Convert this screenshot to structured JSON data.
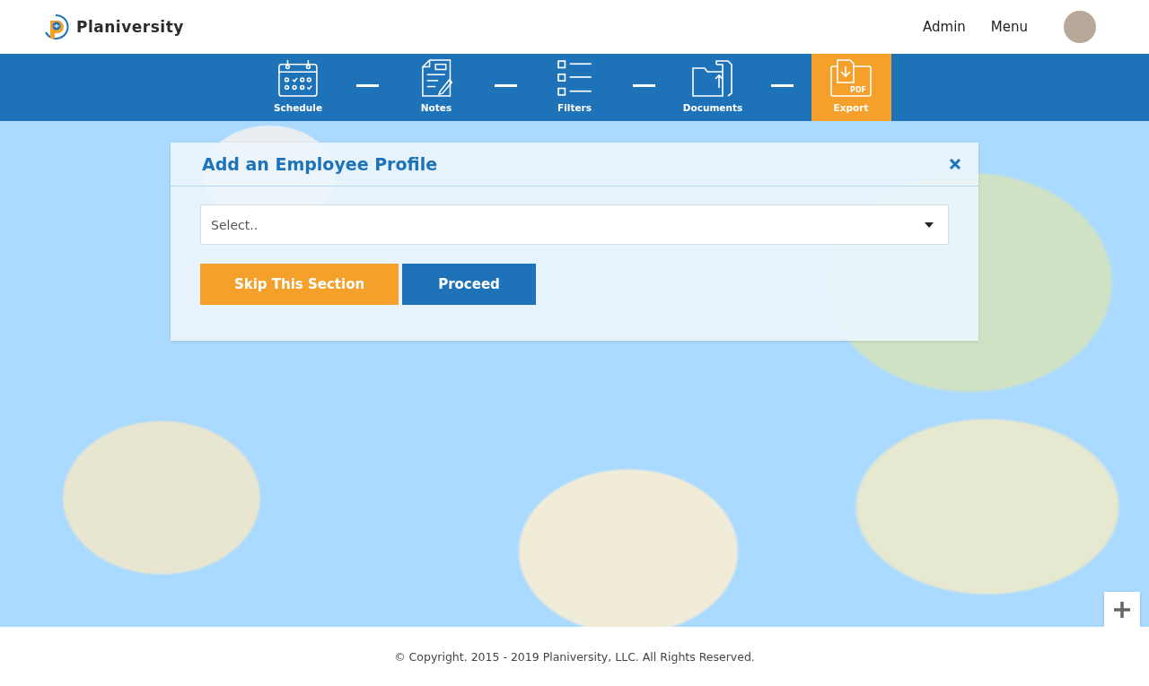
{
  "header": {
    "brand": "Planiversity",
    "nav": [
      {
        "label": "Admin"
      },
      {
        "label": "Menu"
      }
    ]
  },
  "steps": [
    {
      "label": "Schedule",
      "kind": "schedule",
      "selected": false
    },
    {
      "label": "Notes",
      "kind": "notes",
      "selected": false
    },
    {
      "label": "Filters",
      "kind": "filters",
      "selected": false
    },
    {
      "label": "Documents",
      "kind": "documents",
      "selected": false
    },
    {
      "label": "Export",
      "kind": "export",
      "selected": true,
      "tag": "PDF"
    }
  ],
  "dialog": {
    "title": "Add an Employee Profile",
    "select": {
      "placeholder": "Select.."
    },
    "buttons": [
      {
        "label": "Skip This Section",
        "kind": "secondary"
      },
      {
        "label": "Proceed",
        "kind": "primary"
      }
    ]
  },
  "footer": {
    "copyright": "© Copyright. 2015 - 2019 Planiversity, LLC. All Rights Reserved."
  }
}
